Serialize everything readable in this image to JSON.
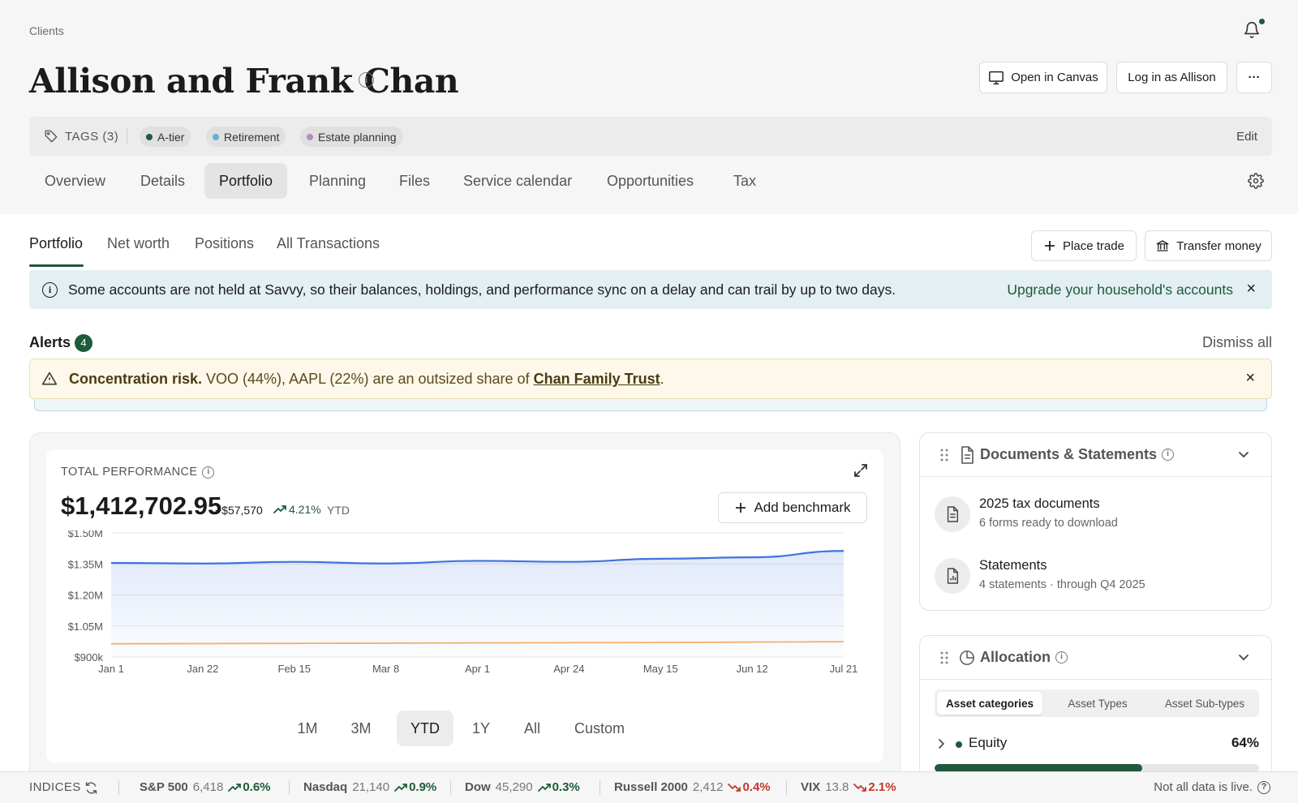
{
  "breadcrumb": "Clients",
  "client_name": "Allison and Frank Chan",
  "header_buttons": {
    "open_canvas": "Open in Canvas",
    "log_in_as": "Log in as Allison",
    "more": "···"
  },
  "tags": {
    "label": "TAGS (3)",
    "items": [
      {
        "label": "A-tier",
        "color": "#1e5a3b"
      },
      {
        "label": "Retirement",
        "color": "#6aaed0"
      },
      {
        "label": "Estate planning",
        "color": "#b48cc4"
      }
    ],
    "edit": "Edit"
  },
  "nav_tabs": [
    "Overview",
    "Details",
    "Portfolio",
    "Planning",
    "Files",
    "Service calendar",
    "Opportunities",
    "Tax"
  ],
  "nav_active": "Portfolio",
  "sub_tabs": [
    "Portfolio",
    "Net worth",
    "Positions",
    "All Transactions"
  ],
  "sub_active": "Portfolio",
  "actions": {
    "place_trade": "Place trade",
    "transfer_money": "Transfer money"
  },
  "banner": {
    "text": "Some accounts are not held at Savvy, so their balances, holdings, and performance sync on a delay and can trail by up to two days.",
    "link": "Upgrade your household's accounts",
    "close": "×"
  },
  "alerts": {
    "title": "Alerts",
    "count": "4",
    "dismiss_all": "Dismiss all",
    "items": [
      {
        "bold": "Concentration risk.",
        "text": " VOO (44%), AAPL (22%) are an outsized share of ",
        "link": "Chan Family Trust",
        "end": ".",
        "close": "×"
      }
    ]
  },
  "performance": {
    "label": "TOTAL PERFORMANCE",
    "value": "$1,412,702.95",
    "change": "+$57,570",
    "change_pct": "4.21%",
    "period": "YTD",
    "add_benchmark": "Add benchmark",
    "ranges": [
      "1M",
      "3M",
      "YTD",
      "1Y",
      "All",
      "Custom"
    ],
    "range_active": "YTD"
  },
  "chart_data": {
    "type": "area",
    "x": [
      "Jan 1",
      "Jan 22",
      "Feb 15",
      "Mar 8",
      "Apr 1",
      "Apr 24",
      "May 15",
      "Jun 12",
      "Jul 21"
    ],
    "y_ticks": [
      "$1.50M",
      "$1.35M",
      "$1.20M",
      "$1.05M",
      "$900k"
    ],
    "ylim": [
      900000,
      1500000
    ],
    "series": [
      {
        "values": [
          1355000,
          1352000,
          1360000,
          1352000,
          1365000,
          1360000,
          1375000,
          1382000,
          1412703
        ],
        "color": "#3f73df"
      },
      {
        "values": [
          964000,
          965000,
          966000,
          967000,
          968000,
          969000,
          970000,
          972000,
          974000
        ],
        "color": "#f4b06b"
      }
    ],
    "grid": true
  },
  "documents": {
    "title": "Documents & Statements",
    "items": [
      {
        "title": "2025 tax documents",
        "subtitle": "6 forms ready to download"
      },
      {
        "title": "Statements",
        "subtitle": "4 statements · through Q4 2025"
      }
    ]
  },
  "allocation": {
    "title": "Allocation",
    "segments": [
      "Asset categories",
      "Asset Types",
      "Asset Sub-types"
    ],
    "segment_active": "Asset categories",
    "rows": [
      {
        "name": "Equity",
        "pct": "64%",
        "fraction": 0.64,
        "color": "#1e5a3b"
      }
    ]
  },
  "ticker": {
    "label": "INDICES",
    "items": [
      {
        "name": "S&P 500",
        "value": "6,418",
        "change": "0.6%",
        "dir": "up"
      },
      {
        "name": "Nasdaq",
        "value": "21,140",
        "change": "0.9%",
        "dir": "up"
      },
      {
        "name": "Dow",
        "value": "45,290",
        "change": "0.3%",
        "dir": "up"
      },
      {
        "name": "Russell 2000",
        "value": "2,412",
        "change": "0.4%",
        "dir": "down"
      },
      {
        "name": "VIX",
        "value": "13.8",
        "change": "2.1%",
        "dir": "down"
      }
    ],
    "note": "Not all data is live."
  }
}
